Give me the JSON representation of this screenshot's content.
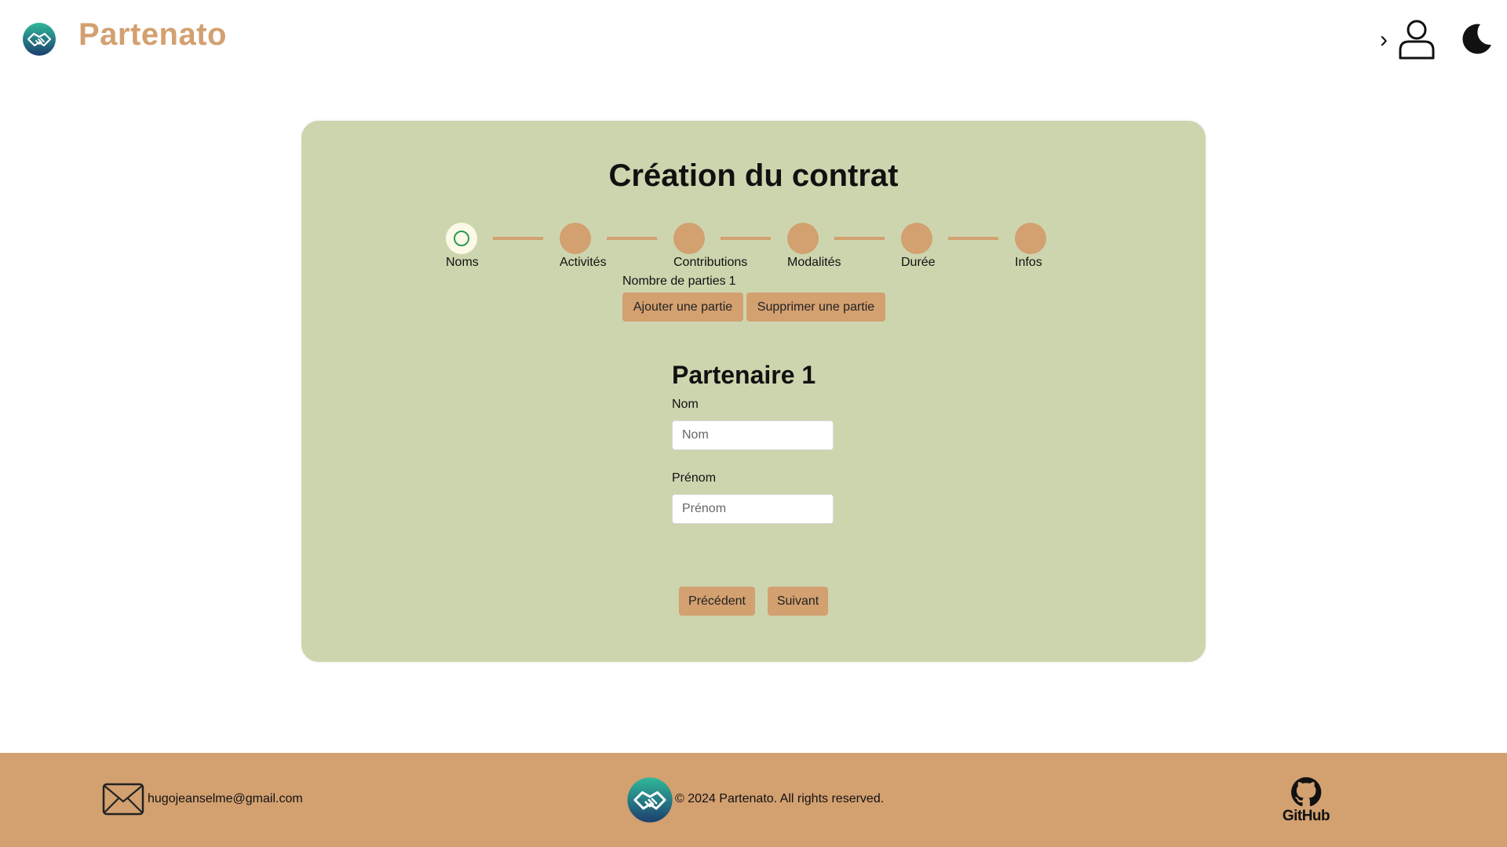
{
  "app": {
    "title": "Partenato"
  },
  "header": {
    "chevron": "›"
  },
  "card": {
    "title": "Création du contrat",
    "steps": [
      {
        "label": "Noms",
        "active": true
      },
      {
        "label": "Activités",
        "active": false
      },
      {
        "label": "Contributions",
        "active": false
      },
      {
        "label": "Modalités",
        "active": false
      },
      {
        "label": "Durée",
        "active": false
      },
      {
        "label": "Infos",
        "active": false
      }
    ],
    "parties": {
      "label": "Nombre de parties",
      "count": "1",
      "add_label": "Ajouter une partie",
      "remove_label": "Supprimer une partie"
    },
    "partner": {
      "title": "Partenaire 1",
      "last_name_label": "Nom",
      "last_name_placeholder": "Nom",
      "last_name_value": "",
      "first_name_label": "Prénom",
      "first_name_placeholder": "Prénom",
      "first_name_value": ""
    },
    "nav": {
      "prev_label": "Précédent",
      "next_label": "Suivant"
    }
  },
  "footer": {
    "email": "hugojeanselme@gmail.com",
    "copyright": "© 2024 Partenato. All rights reserved.",
    "github_label": "GitHub"
  },
  "colors": {
    "accent": "#d3a070",
    "card_bg": "#cdd5ae",
    "active_step_bg": "#fcfae6",
    "active_step_ring": "#2b9a52"
  },
  "icons": {
    "logo": "handshake-logo-icon",
    "user": "user-icon",
    "theme": "moon-icon",
    "mail": "mail-icon",
    "github": "github-icon"
  }
}
